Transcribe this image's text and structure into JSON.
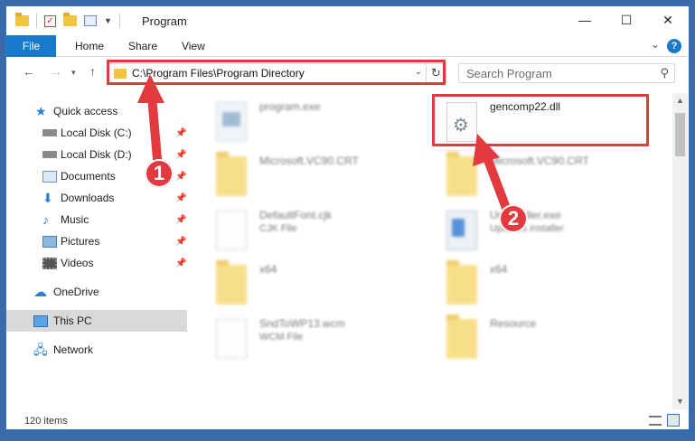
{
  "window": {
    "title": "Program",
    "controls": {
      "minimize": "—",
      "maximize": "☐",
      "close": "✕"
    }
  },
  "ribbon": {
    "tabs": [
      {
        "label": "File"
      },
      {
        "label": "Home"
      },
      {
        "label": "Share"
      },
      {
        "label": "View"
      }
    ],
    "help": "?"
  },
  "nav": {
    "address": "C:\\Program Files\\Program Directory",
    "search_placeholder": "Search Program"
  },
  "sidebar": {
    "items": [
      {
        "label": "Quick access",
        "icon": "star-icon",
        "pinned": false
      },
      {
        "label": "Local Disk (C:)",
        "icon": "disk-icon",
        "pinned": true
      },
      {
        "label": "Local Disk (D:)",
        "icon": "disk-icon",
        "pinned": true
      },
      {
        "label": "Documents",
        "icon": "documents-icon",
        "pinned": true
      },
      {
        "label": "Downloads",
        "icon": "download-icon",
        "pinned": true
      },
      {
        "label": "Music",
        "icon": "music-icon",
        "pinned": true
      },
      {
        "label": "Pictures",
        "icon": "pictures-icon",
        "pinned": true
      },
      {
        "label": "Videos",
        "icon": "videos-icon",
        "pinned": true
      },
      {
        "label": "OneDrive",
        "icon": "cloud-icon",
        "pinned": false
      },
      {
        "label": "This PC",
        "icon": "pc-icon",
        "pinned": false,
        "selected": true
      },
      {
        "label": "Network",
        "icon": "network-icon",
        "pinned": false
      }
    ]
  },
  "files": [
    {
      "name": "program.exe",
      "sub": "",
      "icon": "exe-icon",
      "blurred": true
    },
    {
      "name": "gencomp22.dll",
      "sub": "",
      "icon": "dll-icon",
      "blurred": false
    },
    {
      "name": "Microsoft.VC90.CRT",
      "sub": "",
      "icon": "folder-icon",
      "blurred": true
    },
    {
      "name": "Microsoft.VC90.CRT",
      "sub": "",
      "icon": "folder-icon",
      "blurred": true
    },
    {
      "name": "DefaultFont.cjk",
      "sub": "CJK File",
      "icon": "file-icon",
      "blurred": true
    },
    {
      "name": "Uninstaller.exe",
      "sub": "Updates installer",
      "icon": "installer-icon",
      "blurred": true
    },
    {
      "name": "x64",
      "sub": "",
      "icon": "folder-icon",
      "blurred": true
    },
    {
      "name": "x64",
      "sub": "",
      "icon": "folder-icon",
      "blurred": true
    },
    {
      "name": "SndToWP13.wcm",
      "sub": "WCM File",
      "icon": "file-icon",
      "blurred": true
    },
    {
      "name": "Resource",
      "sub": "",
      "icon": "folder-icon",
      "blurred": true
    }
  ],
  "status": {
    "item_count": "120 items"
  },
  "annotations": {
    "step1": "1",
    "step2": "2",
    "color": "#e23a3e"
  }
}
